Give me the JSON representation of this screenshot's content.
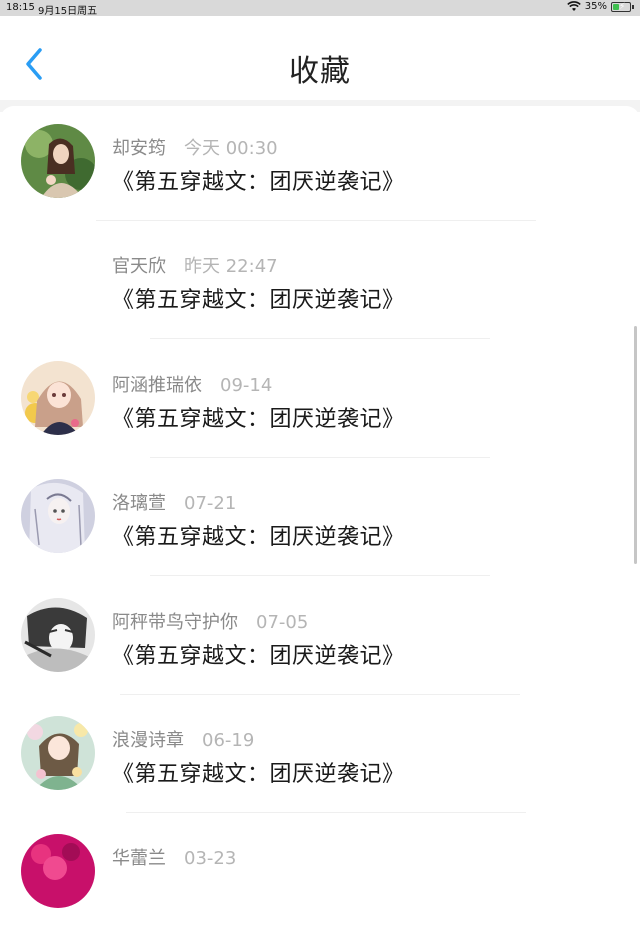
{
  "status_bar": {
    "time": "18:15",
    "date": "9月15日周五",
    "battery": "35%",
    "battery_level": 0.35,
    "battery_color": "#3fbf4f"
  },
  "header": {
    "title": "收藏",
    "back_icon": "chevron-left-icon",
    "back_color": "#2a9df4"
  },
  "items": [
    {
      "name": "却安筠",
      "time": "今天 00:30",
      "title": "《第五穿越文：团厌逆袭记》",
      "avatar": "photo-girl-green"
    },
    {
      "name": "官天欣",
      "time": "昨天 22:47",
      "title": "《第五穿越文：团厌逆袭记》",
      "avatar": ""
    },
    {
      "name": "阿涵推瑞依",
      "time": "09-14",
      "title": "《第五穿越文：团厌逆袭记》",
      "avatar": "anime-girl-pink-hair"
    },
    {
      "name": "洛璃萱",
      "time": "07-21",
      "title": "《第五穿越文：团厌逆袭记》",
      "avatar": "anime-girl-sketch"
    },
    {
      "name": "阿秤带鸟守护你",
      "time": "07-05",
      "title": "《第五穿越文：团厌逆袭记》",
      "avatar": "anime-boy-bw"
    },
    {
      "name": "浪漫诗章",
      "time": "06-19",
      "title": "《第五穿越文：团厌逆袭记》",
      "avatar": "anime-girl-flowers"
    },
    {
      "name": "华蕾兰",
      "time": "03-23",
      "title": "",
      "avatar": "photo-pink-flowers"
    }
  ]
}
